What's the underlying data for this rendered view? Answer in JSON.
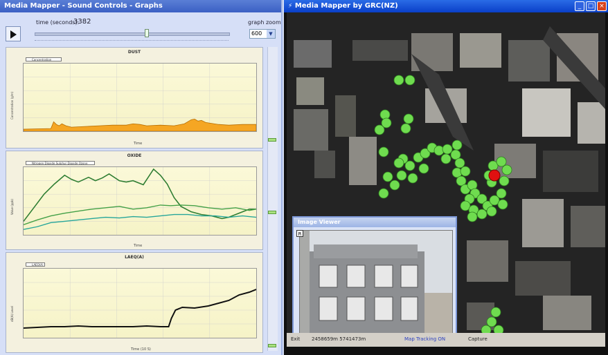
{
  "left_window": {
    "title": "Media Mapper - Sound Controls - Graphs",
    "time_label": "time (seconds):",
    "time_value": "3382",
    "time_progress": 0.58,
    "zoom_label": "graph zoom",
    "zoom_value": "600",
    "panels": [
      {
        "title": "DUST",
        "legend": "Concentration",
        "xlabel": "Time",
        "ylabel": "Concentration (g/m)",
        "yticks": [
          "90",
          "80",
          "70",
          "60",
          "50",
          "40",
          "30",
          "20",
          "10",
          "0"
        ]
      },
      {
        "title": "OXIDE",
        "legend": "Nitrogen Dioxide  Sulphur Dioxide  Ozone",
        "xlabel": "Time",
        "ylabel": "Value (ppb)",
        "yticks": [
          "35",
          "30",
          "25",
          "20",
          "15",
          "10",
          "5",
          "0"
        ]
      },
      {
        "title": "LAEQ(A)",
        "legend": "LAEQ(A)",
        "xlabel": "Time (10 S)",
        "ylabel": "dB(A) Level",
        "yticks": [
          "1.1",
          "1.0",
          "0.9",
          "0.8",
          "0.7",
          "0.6",
          "0.5",
          "0.4",
          "0.3",
          "0.2",
          "0.1",
          "0.0"
        ]
      }
    ],
    "colors": {
      "dust_fill": "#f5a623",
      "oxide_1": "#2e7d32",
      "oxide_2": "#43a047",
      "oxide_3": "#26a69a",
      "laeq": "#111111"
    }
  },
  "right_window": {
    "title": "Media Mapper by GRC(NZ)",
    "min_icon": "minimize-icon",
    "max_icon": "maximize-icon",
    "close_icon": "close-icon",
    "status": {
      "exit": "Exit",
      "coords": "2458659m  5741473m",
      "tracking": "Map Tracking ON",
      "capture": "Capture"
    },
    "image_viewer": {
      "title": "Image Viewer",
      "marker": "R"
    },
    "colors": {
      "point": "#6fdc4f",
      "point_active": "#e01010"
    }
  }
}
